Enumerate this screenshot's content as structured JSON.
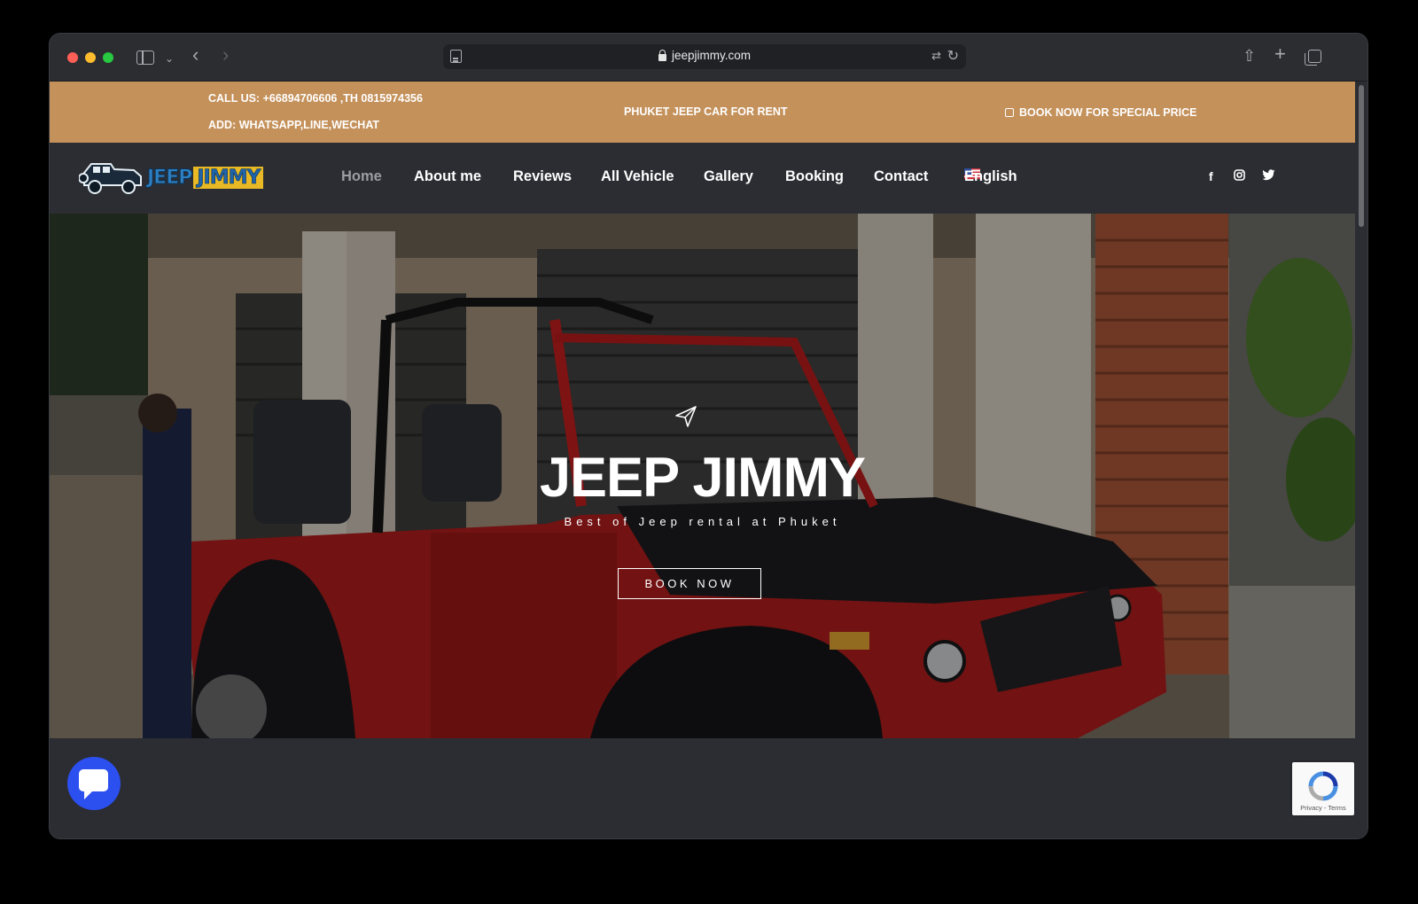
{
  "browser": {
    "url": "jeepjimmy.com"
  },
  "topbar": {
    "call": "CALL US: +66894706606 ,TH 0815974356",
    "add": "ADD: WHATSAPP,LINE,WECHAT",
    "center": "PHUKET JEEP CAR FOR RENT",
    "book": "BOOK NOW FOR SPECIAL PRICE",
    "background_color": "#c4915b"
  },
  "logo": {
    "word1": "JEEP",
    "word2": "JIMMY"
  },
  "nav": {
    "items": [
      {
        "label": "Home",
        "active": true
      },
      {
        "label": "About me"
      },
      {
        "label": "Reviews"
      },
      {
        "label": "All Vehicle"
      },
      {
        "label": "Gallery"
      },
      {
        "label": "Booking"
      },
      {
        "label": "Contact"
      }
    ],
    "language": "English",
    "social": [
      "facebook-icon",
      "instagram-icon",
      "twitter-icon"
    ]
  },
  "hero": {
    "title": "JEEP JIMMY",
    "subtitle": "Best of Jeep rental at Phuket",
    "button": "BOOK NOW"
  },
  "recaptcha": {
    "text": "Privacy - Terms"
  },
  "colors": {
    "chat_button": "#2c4ff0",
    "jeep_body": "#b01d1d"
  }
}
